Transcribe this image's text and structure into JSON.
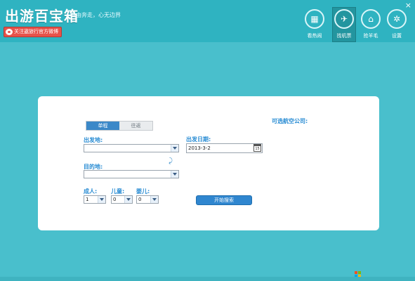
{
  "header": {
    "logo": "出游百宝箱",
    "slogan": "自由奔走，心无边界",
    "follow_button": "关注遨旅行官方微博",
    "close_glyph": "×",
    "nav": [
      {
        "label": "看热闹",
        "icon": "calendar-icon",
        "glyph": "▦",
        "active": false
      },
      {
        "label": "找机票",
        "icon": "plane-icon",
        "glyph": "✈",
        "active": true
      },
      {
        "label": "抢羊毛",
        "icon": "tag-icon",
        "glyph": "⌂",
        "active": false
      },
      {
        "label": "设置",
        "icon": "gear-icon",
        "glyph": "✲",
        "active": false
      }
    ]
  },
  "form": {
    "tabs": [
      "单程",
      "往返"
    ],
    "active_tab": 0,
    "departure_label": "出发地:",
    "departure_value": "",
    "destination_label": "目的地:",
    "destination_value": "",
    "date_label": "出发日期:",
    "date_value": "2013-3-2",
    "calendar_glyph": "15",
    "swap_glyph": "⤸",
    "adults_label": "成人:",
    "adults_value": "1",
    "children_label": "儿童:",
    "children_value": "0",
    "infants_label": "婴儿:",
    "infants_value": "0",
    "search_button": "开始搜索",
    "airline_label": "可选航空公司:"
  },
  "colors": {
    "background": "#49bfcc",
    "header": "#2fb3c1",
    "accent": "#2f86cf",
    "label": "#278bd3",
    "follow_button": "#e7524a"
  }
}
